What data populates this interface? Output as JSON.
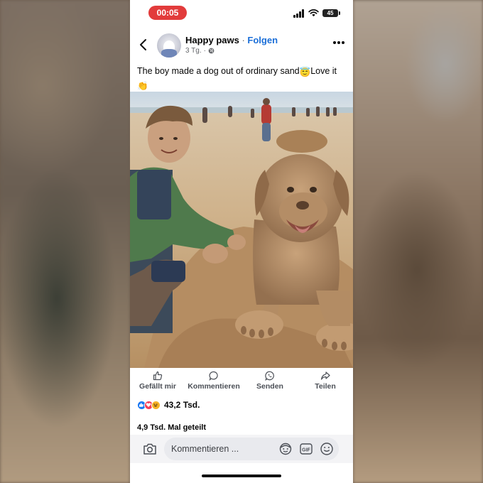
{
  "status_bar": {
    "time": "00:05",
    "battery": "45"
  },
  "post": {
    "page_name": "Happy paws",
    "separator": " · ",
    "follow_label": "Folgen",
    "age": "3 Tg.",
    "meta_separator": " · ",
    "caption_part1": "The boy made a dog out of ordinary sand",
    "caption_emoji1": "😇",
    "caption_part2": "Love it",
    "caption_emoji2": "👏"
  },
  "actions": {
    "like_label": "Gefällt mir",
    "comment_label": "Kommentieren",
    "send_label": "Senden",
    "share_label": "Teilen"
  },
  "engagement": {
    "reaction_count": "43,2 Tsd.",
    "shares_text": "4,9 Tsd. Mal geteilt"
  },
  "comment_bar": {
    "placeholder": "Kommentieren ..."
  },
  "colors": {
    "accent_blue": "#1a6ed8",
    "status_red": "#e23b3b",
    "like_blue": "#1877f2",
    "love_red": "#f33e58",
    "haha_yellow": "#f7b125"
  }
}
